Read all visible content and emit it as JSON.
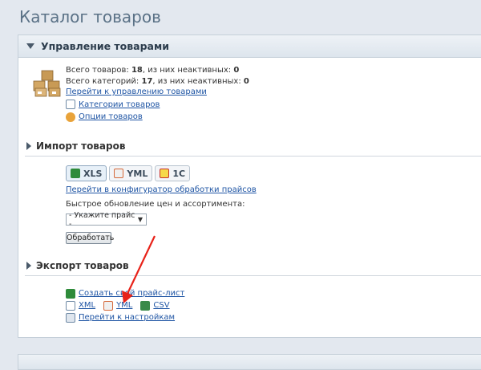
{
  "page": {
    "title": "Каталог товаров"
  },
  "manage": {
    "title": "Управление товарами",
    "stat1": {
      "label": "Всего товаров: ",
      "count": "18",
      "mid": ", из них неактивных: ",
      "inactive": "0"
    },
    "stat2": {
      "label": "Всего категорий: ",
      "count": "17",
      "mid": ", из них неактивных: ",
      "inactive": "0"
    },
    "link_manage": "Перейти к управлению товарами",
    "link_categories": "Категории товаров",
    "link_options": "Опции товаров"
  },
  "import": {
    "title": "Импорт товаров",
    "tabs": [
      {
        "label": "XLS",
        "icon": "excel-icon"
      },
      {
        "label": "YML",
        "icon": "yml-icon"
      },
      {
        "label": "1C",
        "icon": "1c-icon"
      }
    ],
    "link_config": "Перейти в конфигуратор обработки прайсов",
    "quick_label": "Быстрое обновление цен и ассортимента:",
    "select_value": "- Укажите прайс -",
    "process_button": "Обработать"
  },
  "export": {
    "title": "Экспорт товаров",
    "link_create": "Создать свой прайс-лист",
    "formats": [
      "XML",
      "YML",
      "CSV"
    ],
    "link_settings": "Перейти к настройкам"
  },
  "colors": {
    "link": "#1f55a4",
    "annotation_arrow": "#e8231a"
  }
}
